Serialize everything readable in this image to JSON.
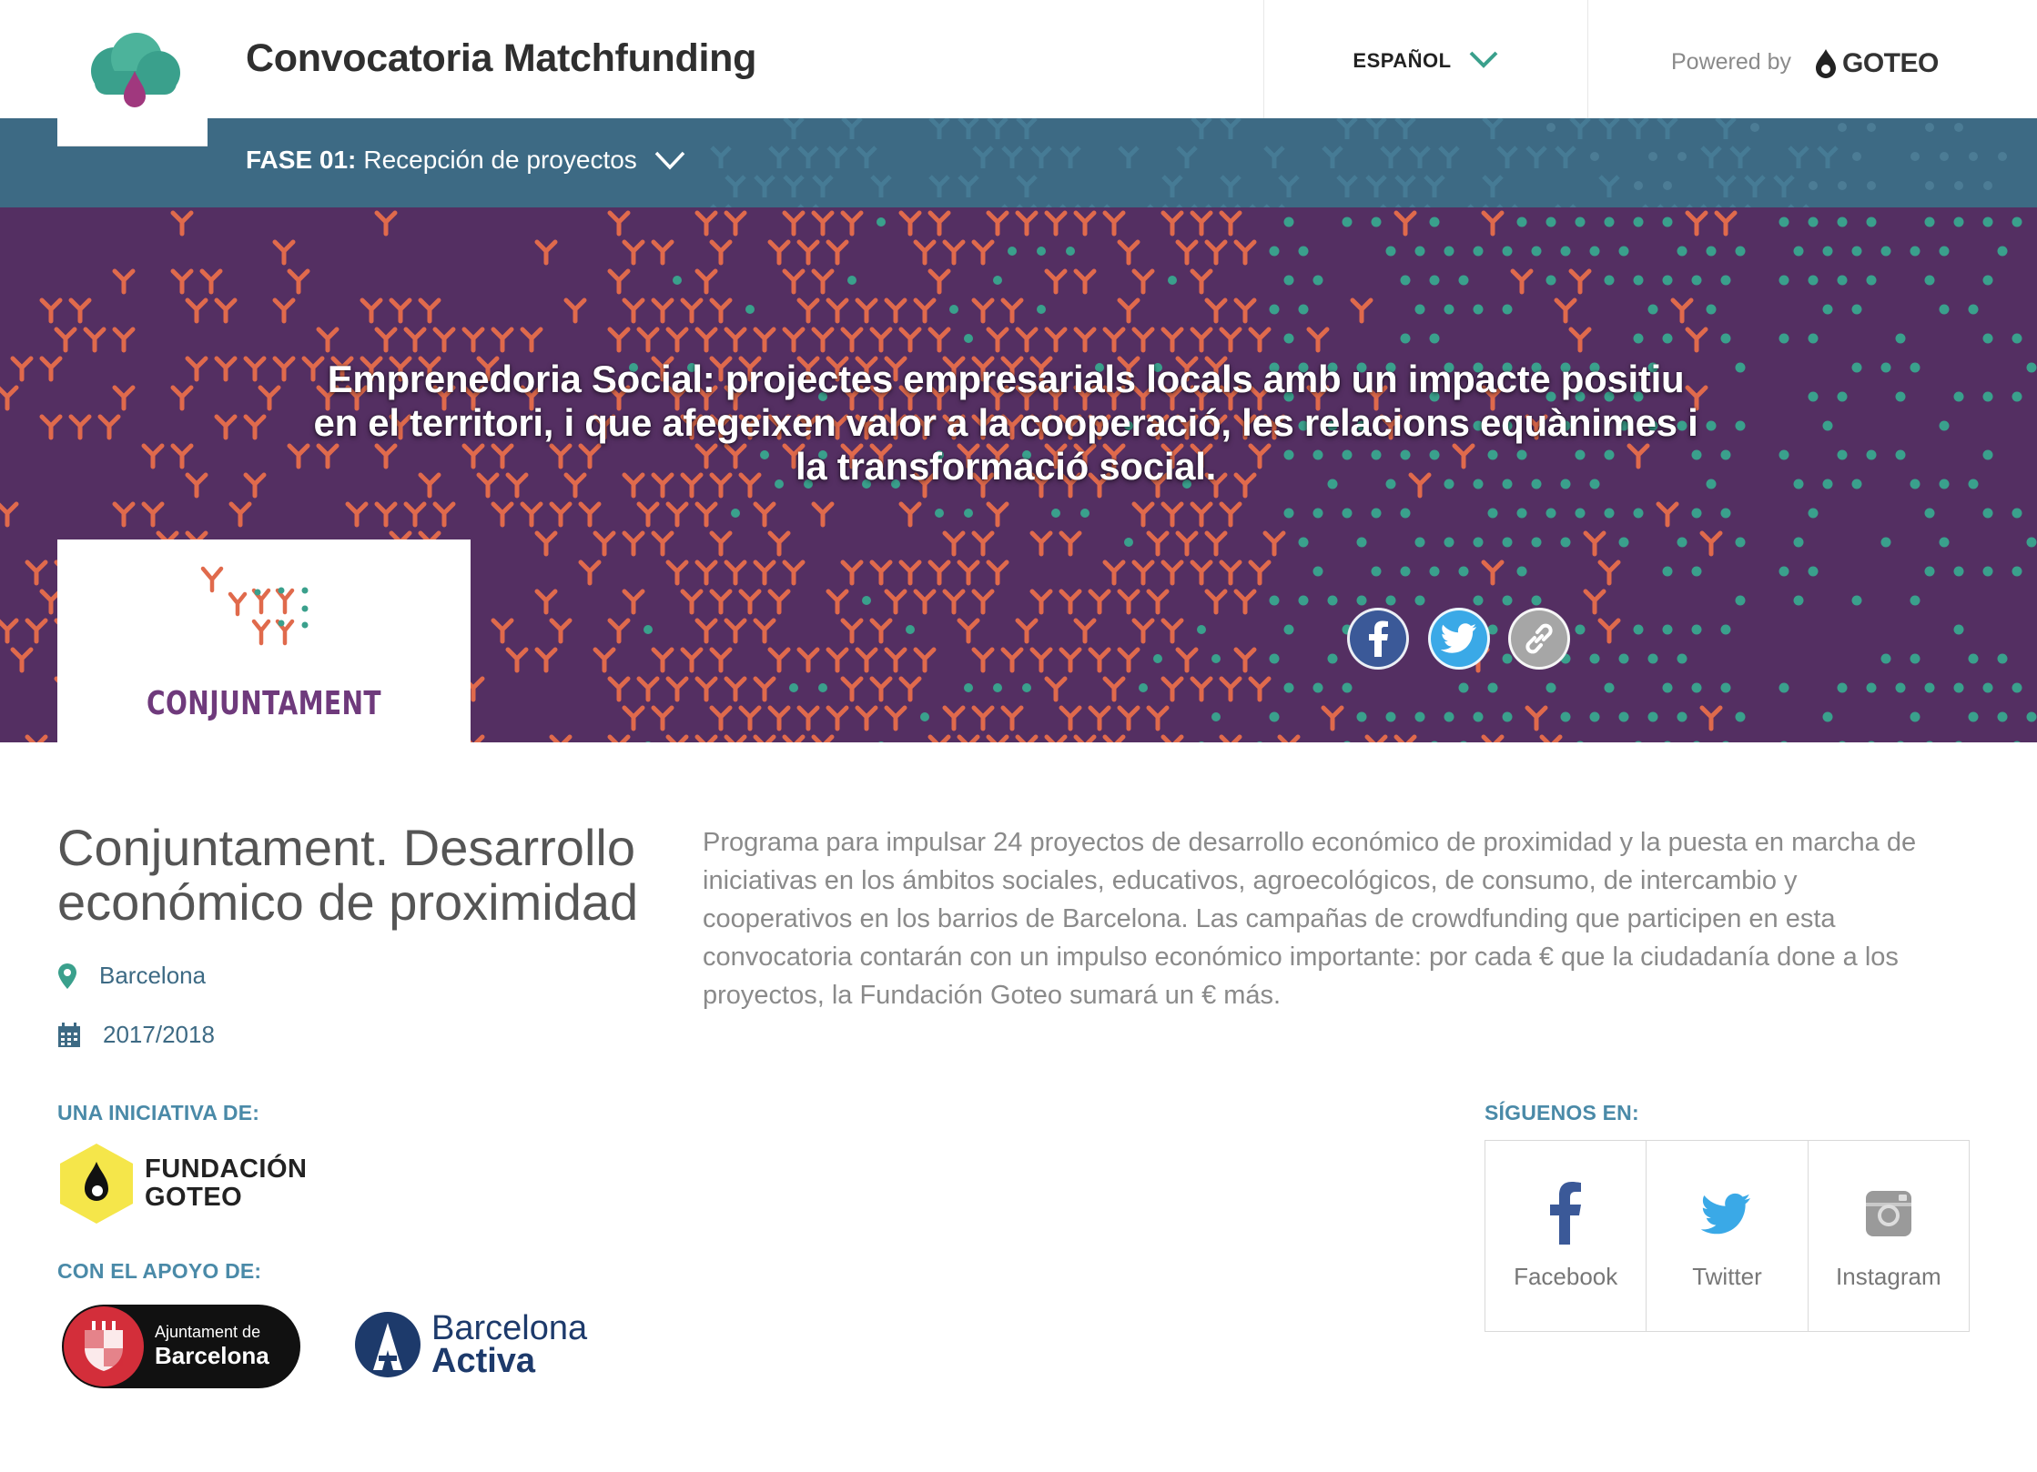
{
  "header": {
    "site_title": "Convocatoria Matchfunding",
    "language": "ESPAÑOL",
    "powered_by": "Powered by",
    "goteo_brand": "GOTEO"
  },
  "phase": {
    "label": "FASE 01:",
    "name": "Recepción de proyectos"
  },
  "hero": {
    "headline": "Emprenedoria Social: projectes empresarials locals amb un impacte positiu en el territori, i que afegeixen valor a la cooperació, les relacions equànimes i la transformació social.",
    "logo_name": "CONJUNTAMENT",
    "share_icons": [
      "facebook-icon",
      "twitter-icon",
      "link-icon"
    ]
  },
  "call": {
    "title": "Conjuntament. Desarrollo económico de proximidad",
    "location": "Barcelona",
    "dates": "2017/2018",
    "description": "Programa para impulsar 24 proyectos de desarrollo económico de proximidad y la puesta en marcha de iniciativas en los ámbitos sociales, educativos, agroecológicos, de consumo, de intercambio y cooperativos en los barrios de Barcelona. Las campañas de crowdfunding que participen en esta convocatoria contarán con un impulso económico importante: por cada € que la ciudadanía done a los proyectos, la Fundación Goteo sumará un € más."
  },
  "initiative": {
    "label": "UNA INICIATIVA DE:",
    "org_line1": "FUNDACIÓN",
    "org_line2": "GOTEO"
  },
  "support": {
    "label": "CON EL APOYO DE:",
    "ajuntament_line1": "Ajuntament de",
    "ajuntament_line2": "Barcelona",
    "activa_line1": "Barcelona",
    "activa_line2": "Activa"
  },
  "follow": {
    "label": "SÍGUENOS EN:",
    "items": [
      {
        "label": "Facebook",
        "icon": "facebook-icon"
      },
      {
        "label": "Twitter",
        "icon": "twitter-icon"
      },
      {
        "label": "Instagram",
        "icon": "instagram-icon"
      }
    ]
  },
  "colors": {
    "phase_bar": "#3d6a84",
    "hero_bg": "#542f62",
    "accent_teal": "#3aa08c",
    "accent_coral": "#e06a4c",
    "link_blue": "#3d6a84"
  }
}
